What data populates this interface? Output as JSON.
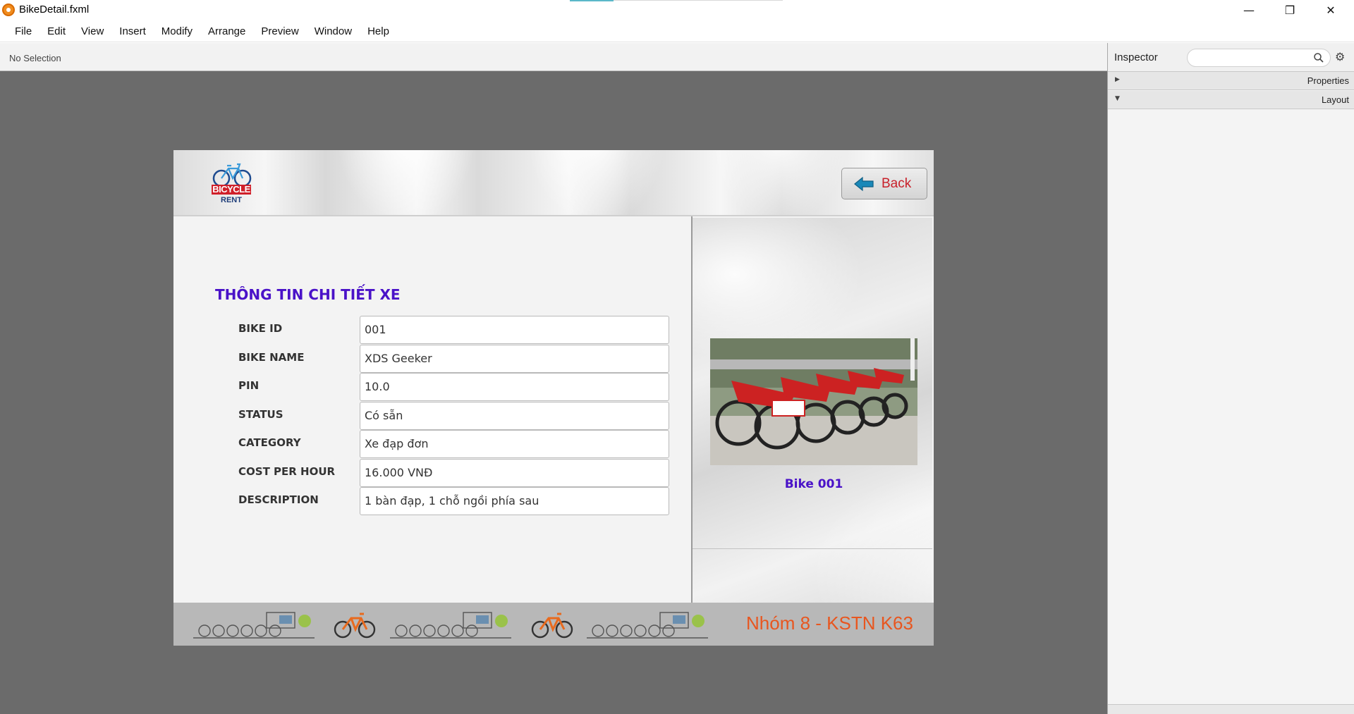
{
  "window": {
    "title": "BikeDetail.fxml",
    "controls": {
      "minimize": "—",
      "maximize": "❐",
      "close": "✕"
    }
  },
  "menu": [
    "File",
    "Edit",
    "View",
    "Insert",
    "Modify",
    "Arrange",
    "Preview",
    "Window",
    "Help"
  ],
  "status": {
    "selection": "No Selection"
  },
  "inspector": {
    "title": "Inspector",
    "search_placeholder": "",
    "sections": [
      {
        "label": "Properties",
        "expanded": false
      },
      {
        "label": "Layout",
        "expanded": true
      }
    ]
  },
  "scene": {
    "logo": {
      "line1": "BICYCLE",
      "line2": "RENT"
    },
    "back_button": "Back",
    "section_title": "THÔNG TIN CHI TIẾT XE",
    "fields": [
      {
        "label": "BIKE ID",
        "value": "001"
      },
      {
        "label": "BIKE NAME",
        "value": "XDS Geeker"
      },
      {
        "label": "PIN",
        "value": "10.0"
      },
      {
        "label": "STATUS",
        "value": "Có sẵn"
      },
      {
        "label": "CATEGORY",
        "value": "Xe đạp đơn"
      },
      {
        "label": "COST PER HOUR",
        "value": "16.000 VNĐ"
      },
      {
        "label": "DESCRIPTION",
        "value": "1 bàn đạp, 1 chỗ ngồi phía sau"
      }
    ],
    "image_caption": "Bike 001",
    "footer_text": "Nhóm 8 - KSTN K63"
  },
  "colors": {
    "title_purple": "#4a12c8",
    "back_red": "#c8202a",
    "footer_orange": "#e8561f",
    "canvas_gray": "#6b6b6b"
  }
}
